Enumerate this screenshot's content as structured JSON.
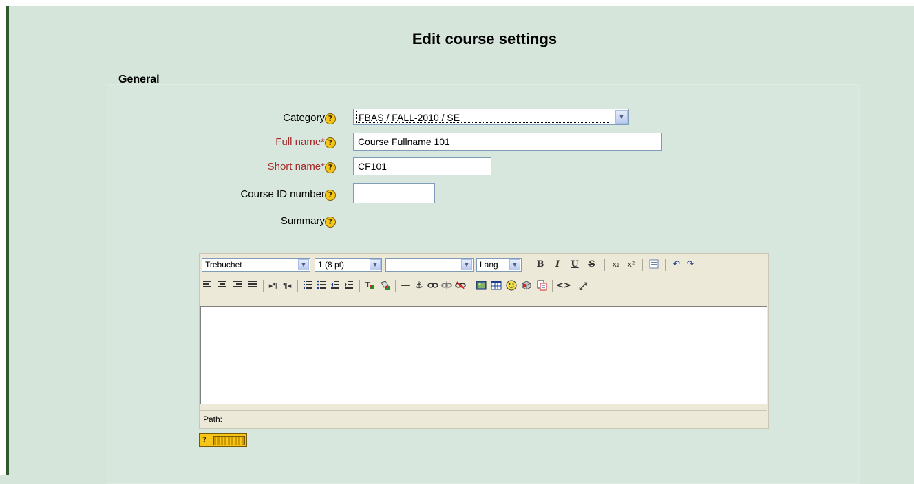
{
  "title": "Edit course settings",
  "section_legend": "General",
  "fields": {
    "category": {
      "label": "Category",
      "value": "FBAS / FALL-2010 / SE"
    },
    "fullname": {
      "label": "Full name*",
      "value": "Course Fullname 101"
    },
    "shortname": {
      "label": "Short name*",
      "value": "CF101"
    },
    "idnumber": {
      "label": "Course ID number",
      "value": ""
    },
    "summary": {
      "label": "Summary"
    }
  },
  "help_glyph": "?",
  "editor": {
    "font_family": "Trebuchet",
    "font_size": "1 (8 pt)",
    "heading": "",
    "lang": "Lang",
    "path_label": "Path:",
    "buttons": {
      "bold": "B",
      "italic": "I",
      "underline": "U",
      "strike": "S",
      "subscript": "x₂",
      "superscript": "x²",
      "undo": "↶",
      "redo": "↷",
      "hr": "—",
      "anchor": "⚓",
      "source": "<>",
      "fullscreen": "⤢"
    }
  },
  "icons": {
    "help": "help-icon",
    "dropdown": "chevron-down-icon"
  },
  "colors": {
    "background": "#d6e5da",
    "required_label": "#a52a2a",
    "accent_bar": "#2e5a2e"
  }
}
